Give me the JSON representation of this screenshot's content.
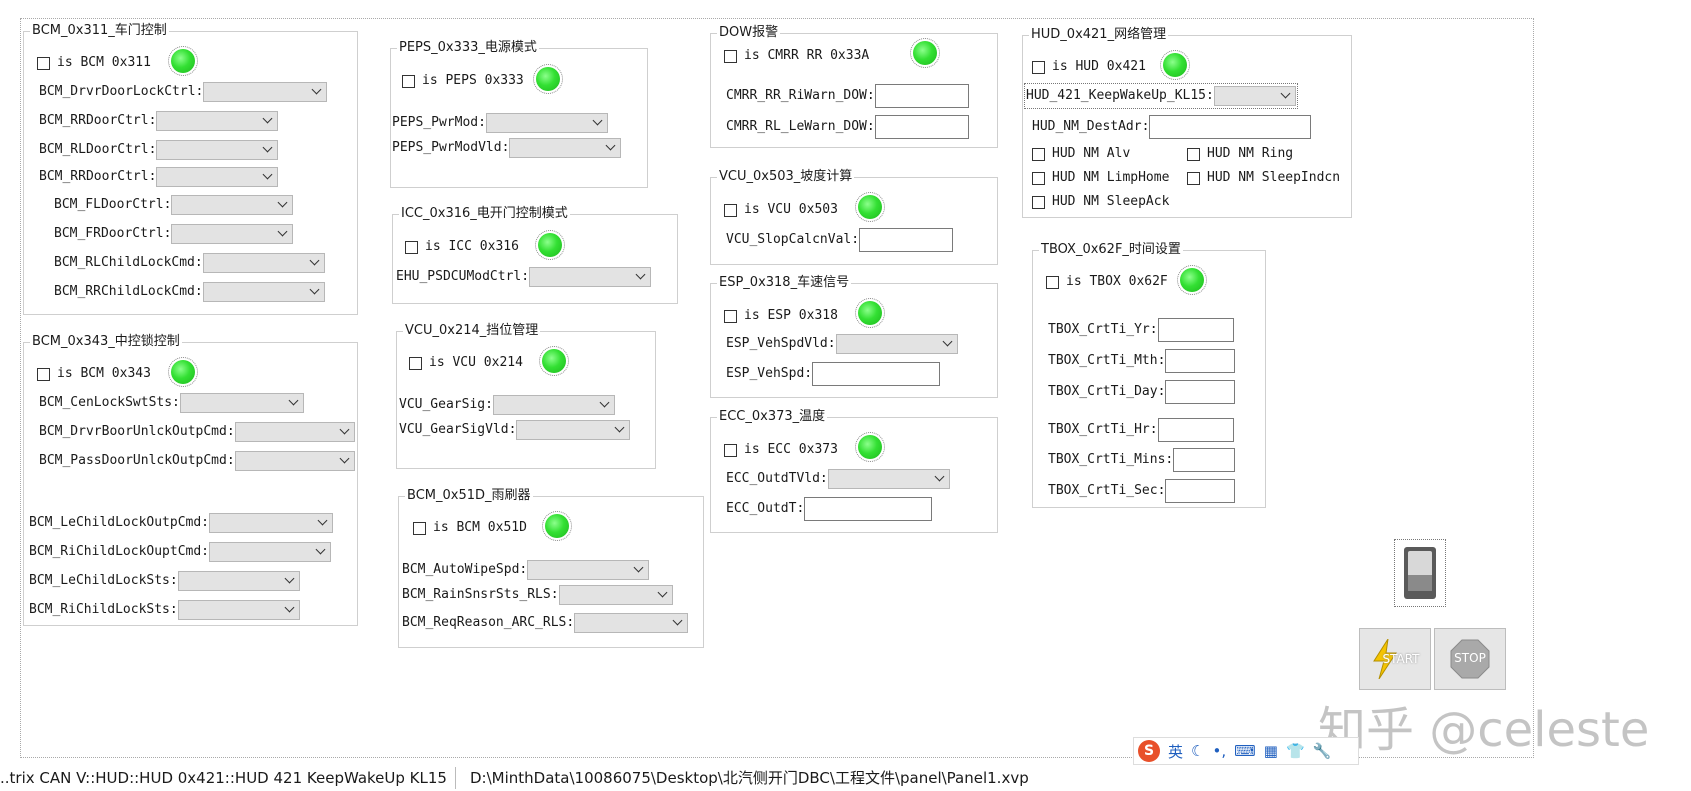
{
  "groups": {
    "g1": {
      "title": "BCM_0x311_车门控制",
      "check": "is BCM 0x311",
      "fields": [
        "BCM_DrvrDoorLockCtrl:",
        "BCM_RRDoorCtrl:",
        "BCM_RLDoorCtrl:",
        "BCM_RRDoorCtrl:",
        "BCM_FLDoorCtrl:",
        "BCM_FRDoorCtrl:",
        "BCM_RLChildLockCmd:",
        "BCM_RRChildLockCmd:"
      ]
    },
    "g2": {
      "title": "BCM_0x343_中控锁控制",
      "check": "is BCM 0x343",
      "fields": [
        "BCM_CenLockSwtSts:",
        "BCM_DrvrBoorUnlckOutpCmd:",
        "BCM_PassDoorUnlckOutpCmd:",
        "BCM_LeChildLockOutpCmd:",
        "BCM_RiChildLockOuptCmd:",
        "BCM_LeChildLockSts:",
        "BCM_RiChildLockSts:"
      ]
    },
    "g3": {
      "title": "PEPS_0x333_电源模式",
      "check": "is PEPS 0x333",
      "fields": [
        "PEPS_PwrMod:",
        "PEPS_PwrModVld:"
      ]
    },
    "g4": {
      "title": "ICC_0x316_电开门控制模式",
      "check": "is ICC 0x316",
      "fields": [
        "EHU_PSDCUModCtrl:"
      ]
    },
    "g5": {
      "title": "VCU_0x214_挡位管理",
      "check": "is VCU 0x214",
      "fields": [
        "VCU_GearSig:",
        "VCU_GearSigVld:"
      ]
    },
    "g6": {
      "title": "BCM_0x51D_雨刷器",
      "check": "is BCM 0x51D",
      "fields": [
        "BCM_AutoWipeSpd:",
        "BCM_RainSnsrSts_RLS:",
        "BCM_ReqReason_ARC_RLS:"
      ]
    },
    "g7": {
      "title": "DOW报警",
      "check": "is CMRR RR 0x33A",
      "fields": [
        "CMRR_RR_RiWarn_DOW:",
        "CMRR_RL_LeWarn_DOW:"
      ]
    },
    "g8": {
      "title": "VCU_0x503_坡度计算",
      "check": "is VCU 0x503",
      "fields": [
        "VCU_SlopCalcnVal:"
      ]
    },
    "g9": {
      "title": "ESP_0x318_车速信号",
      "check": "is ESP 0x318",
      "fields": [
        "ESP_VehSpdVld:",
        "ESP_VehSpd:"
      ]
    },
    "g10": {
      "title": "ECC_0x373_温度",
      "check": "is ECC 0x373",
      "fields": [
        "ECC_OutdTVld:",
        "ECC_OutdT:"
      ]
    },
    "g11": {
      "title": "HUD_0x421_网络管理",
      "check": "is HUD 0x421",
      "fields": [
        "HUD_421_KeepWakeUp_KL15:",
        "HUD_NM_DestAdr:"
      ],
      "checks": [
        "HUD NM Alv",
        "HUD NM Ring",
        "HUD NM LimpHome",
        "HUD NM SleepIndcn",
        "HUD NM SleepAck"
      ]
    },
    "g12": {
      "title": "TBOX_0x62F_时间设置",
      "check": "is TBOX 0x62F",
      "fields": [
        "TBOX_CrtTi_Yr:",
        "TBOX_CrtTi_Mth:",
        "TBOX_CrtTi_Day:",
        "TBOX_CrtTi_Hr:",
        "TBOX_CrtTi_Mins:",
        "TBOX_CrtTi_Sec:"
      ]
    }
  },
  "controls": {
    "start_label": "START",
    "stop_label": "STOP"
  },
  "status": {
    "left": "..trix CAN V::HUD::HUD 0x421::HUD 421 KeepWakeUp KL15",
    "right": "D:\\MinthData\\10086075\\Desktop\\北汽侧开门DBC\\工程文件\\panel\\Panel1.xvp"
  },
  "ime": {
    "lang": "英"
  },
  "watermark": "知乎 @celeste",
  "colors": {
    "led_green": "#33e033",
    "combo_bg": "#e3e3e3",
    "start_bolt": "#f5c400"
  }
}
